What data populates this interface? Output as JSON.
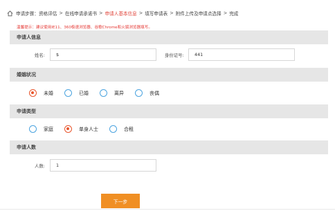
{
  "steps": {
    "prefix": "申请步骤：",
    "items": [
      "资格评估",
      "在线申请承诺书",
      "申请人基本信息",
      "填写申请表",
      "附件上传及申请点选择",
      "完成"
    ],
    "separator": ">",
    "active_index": 2
  },
  "notice": "温馨提示：建议使用IE11、360极速浏览器、谷歌Chrome和火狐浏览器填写。",
  "sections": {
    "applicant_info": "申请人信息",
    "marital_status": "婚姻状况",
    "application_type": "申请类型",
    "applicant_count": "申请人数"
  },
  "fields": {
    "name_label": "姓名:",
    "name_value": "$",
    "id_label": "身份证号:",
    "id_value": "441",
    "count_label": "人数:",
    "count_value": "1"
  },
  "marital_options": [
    {
      "label": "未婚",
      "checked": true
    },
    {
      "label": "已婚",
      "checked": false
    },
    {
      "label": "离异",
      "checked": false
    },
    {
      "label": "丧偶",
      "checked": false
    }
  ],
  "type_options": [
    {
      "label": "家庭",
      "checked": false
    },
    {
      "label": "单身人士",
      "checked": true
    },
    {
      "label": "合租",
      "checked": false
    }
  ],
  "buttons": {
    "next": "下一步"
  },
  "colors": {
    "accent": "#e0443a",
    "radio_checked": "#e8552c",
    "radio_unchecked": "#4aa3df",
    "button": "#f08f24",
    "section_bg": "#e6e6e6"
  }
}
